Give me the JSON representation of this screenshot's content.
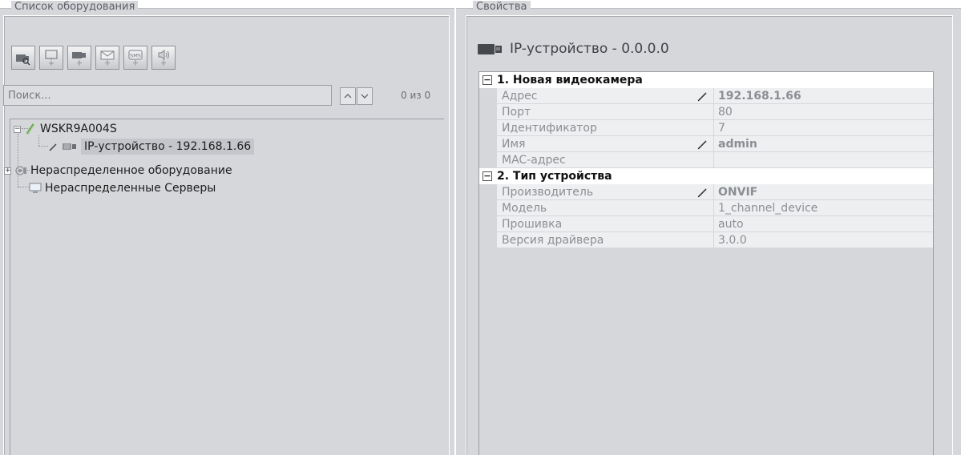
{
  "left_panel": {
    "title": "Список оборудования",
    "toolbar": [
      {
        "name": "add-camera-button",
        "icon": "camera-search-icon"
      },
      {
        "name": "add-server-button",
        "icon": "monitor-plus-icon"
      },
      {
        "name": "add-ip-device-button",
        "icon": "camera-plus-icon"
      },
      {
        "name": "add-email-button",
        "icon": "envelope-plus-icon"
      },
      {
        "name": "add-sms-button",
        "icon": "sms-plus-icon"
      },
      {
        "name": "add-speaker-button",
        "icon": "speaker-plus-icon"
      }
    ],
    "search": {
      "placeholder": "Поиск...",
      "value": ""
    },
    "count": "0 из 0",
    "tree": [
      {
        "label": "WSKR9A004S",
        "icon": "server-icon",
        "expanded": true
      },
      {
        "label": "IP-устройство - 192.168.1.66",
        "icon": "ip-device-icon",
        "selected": true
      },
      {
        "label": "Нераспределенное оборудование",
        "icon": "unassigned-device-icon",
        "expanded": false
      },
      {
        "label": "Нераспределенные Серверы",
        "icon": "computer-icon"
      }
    ]
  },
  "right_panel": {
    "title": "Свойства",
    "device_title": "IP-устройство - 0.0.0.0",
    "categories": [
      {
        "label": "1. Новая видеокамера",
        "rows": [
          {
            "name": "Адрес",
            "value": "192.168.1.66",
            "editable": true
          },
          {
            "name": "Порт",
            "value": "80",
            "editable": false
          },
          {
            "name": "Идентификатор",
            "value": "7",
            "editable": false
          },
          {
            "name": "Имя",
            "value": "admin",
            "editable": true
          },
          {
            "name": "MAC-адрес",
            "value": "",
            "editable": false
          }
        ]
      },
      {
        "label": "2. Тип устройства",
        "rows": [
          {
            "name": "Производитель",
            "value": "ONVIF",
            "editable": true
          },
          {
            "name": "Модель",
            "value": "1_channel_device",
            "editable": false
          },
          {
            "name": "Прошивка",
            "value": "auto",
            "editable": false
          },
          {
            "name": "Версия драйвера",
            "value": "3.0.0",
            "editable": false
          }
        ]
      }
    ]
  },
  "colors": {
    "panel_bg": "#d6d7db",
    "row_bg": "#eeeff1",
    "category_bg": "#ffffff",
    "muted_text": "#8b8e93"
  }
}
